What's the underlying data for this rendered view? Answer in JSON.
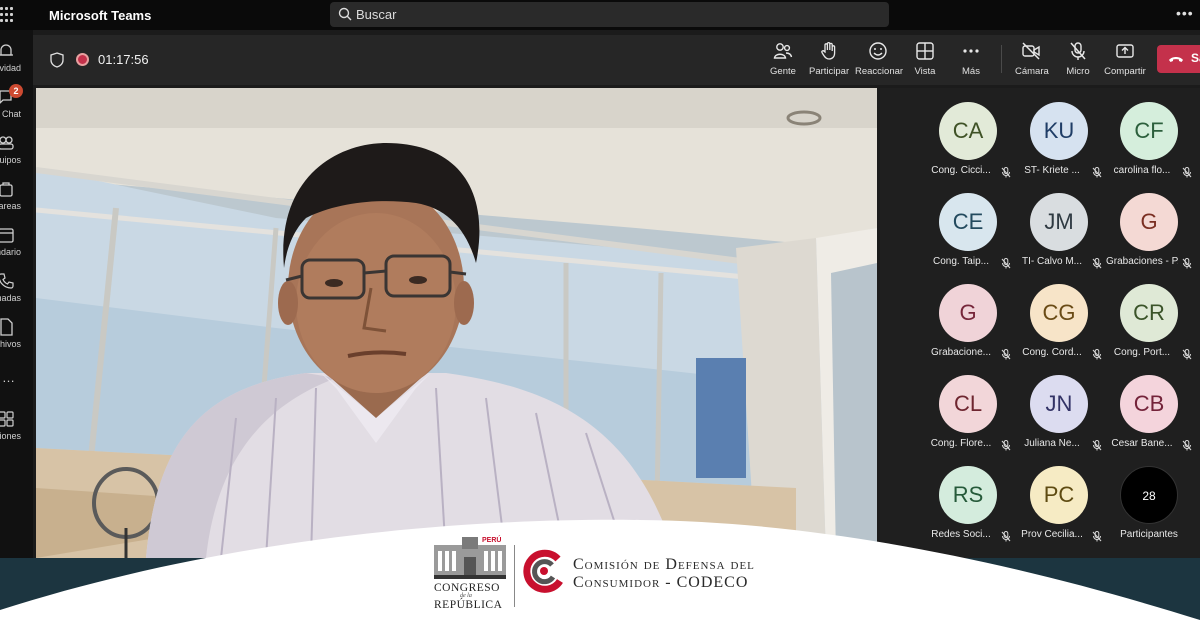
{
  "app": {
    "name": "Microsoft Teams"
  },
  "search": {
    "placeholder": "Buscar"
  },
  "rail": {
    "items": [
      {
        "label": "Actividad",
        "icon": "bell-icon"
      },
      {
        "label": "Chat",
        "icon": "chat-icon",
        "badge": "2"
      },
      {
        "label": "Equipos",
        "icon": "teams-icon"
      },
      {
        "label": "Tareas",
        "icon": "tasks-icon"
      },
      {
        "label": "Calendario",
        "icon": "calendar-icon"
      },
      {
        "label": "Llamadas",
        "icon": "phone-icon"
      },
      {
        "label": "Archivos",
        "icon": "files-icon"
      },
      {
        "label": "…",
        "icon": "more-icon"
      },
      {
        "label": "Aplicaciones",
        "icon": "apps-icon"
      }
    ]
  },
  "meeting": {
    "timer": "01:17:56",
    "toolbar": {
      "people": "Gente",
      "raise_hand": "Participar",
      "react": "Reaccionar",
      "view": "Vista",
      "more": "Más",
      "camera": "Cámara",
      "mic": "Micro",
      "share": "Compartir",
      "leave": "Sa"
    }
  },
  "participants": [
    {
      "initials": "CA",
      "name": "Cong. Cicci...",
      "bg": "#e2ead8",
      "fg": "#3f5226"
    },
    {
      "initials": "KU",
      "name": "ST- Kriete ...",
      "bg": "#d6e2f0",
      "fg": "#1f3d66"
    },
    {
      "initials": "CF",
      "name": "carolina flo...",
      "bg": "#d5eedc",
      "fg": "#2c5f3c"
    },
    {
      "initials": "CE",
      "name": "Cong. Taip...",
      "bg": "#d8e6ee",
      "fg": "#234a5e"
    },
    {
      "initials": "JM",
      "name": "TI- Calvo M...",
      "bg": "#d9dde0",
      "fg": "#2f3a42"
    },
    {
      "initials": "G",
      "name": "Grabaciones - P...",
      "bg": "#f4d9d4",
      "fg": "#7a2f22"
    },
    {
      "initials": "G",
      "name": "Grabacione...",
      "bg": "#f0d3d8",
      "fg": "#76263a"
    },
    {
      "initials": "CG",
      "name": "Cong. Cord...",
      "bg": "#f7e4c8",
      "fg": "#6a4b16"
    },
    {
      "initials": "CR",
      "name": "Cong. Port...",
      "bg": "#dfe9d6",
      "fg": "#3b5429"
    },
    {
      "initials": "CL",
      "name": "Cong. Flore...",
      "bg": "#f2d6d9",
      "fg": "#6e2630"
    },
    {
      "initials": "JN",
      "name": "Juliana Ne...",
      "bg": "#dcdcf0",
      "fg": "#333366"
    },
    {
      "initials": "CB",
      "name": "Cesar Bane...",
      "bg": "#f4d4dc",
      "fg": "#74233a"
    },
    {
      "initials": "RS",
      "name": "Redes Soci...",
      "bg": "#d4ecdd",
      "fg": "#265a3a"
    },
    {
      "initials": "PC",
      "name": "Prov Cecilia...",
      "bg": "#f6ebc4",
      "fg": "#5e4b12"
    },
    {
      "initials": "28",
      "name": "Participantes",
      "bg": "#000000",
      "fg": "#ffffff"
    }
  ],
  "banner": {
    "congreso_peru": "PERÚ",
    "congreso_line1": "CONGRESO",
    "congreso_line2": "de la",
    "congreso_line3": "REPÚBLICA",
    "codeco_line1": "Comisión de Defensa del",
    "codeco_line2": "Consumidor - CODECO"
  },
  "colors": {
    "accent_red": "#c4314b",
    "toolbar_bg": "#262626",
    "banner_bg": "#1c3540"
  }
}
